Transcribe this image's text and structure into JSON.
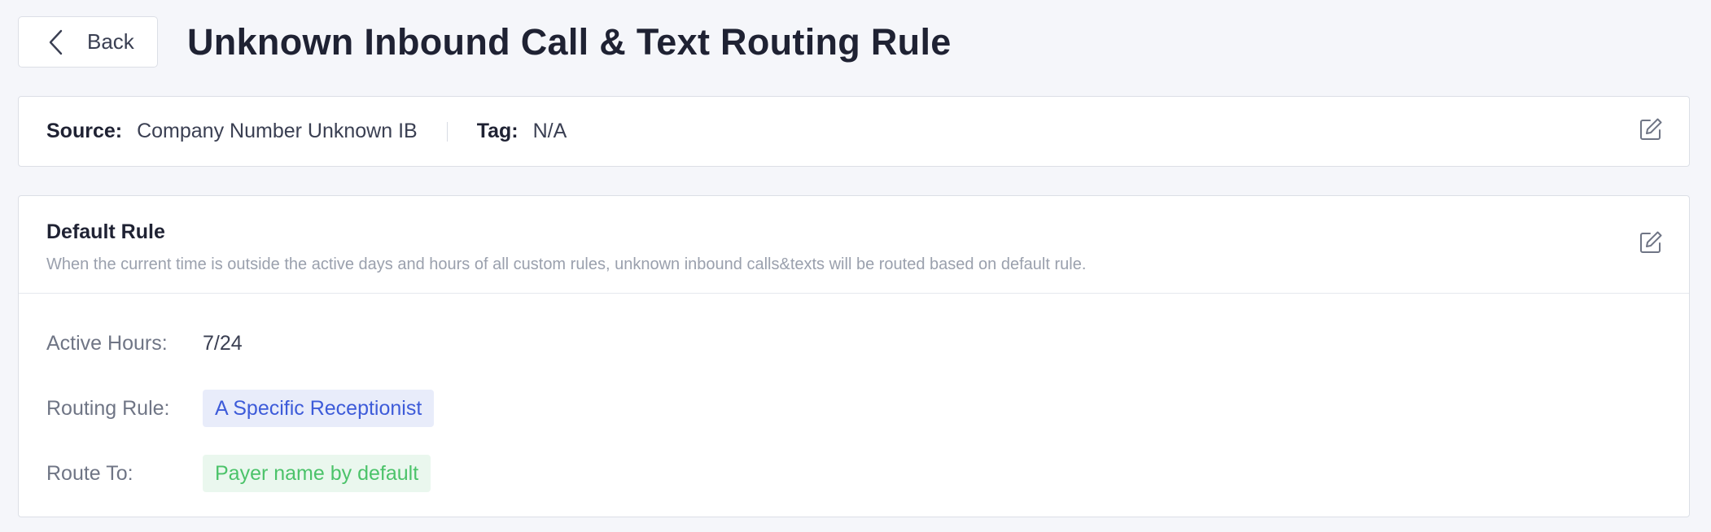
{
  "header": {
    "back_label": "Back",
    "title": "Unknown Inbound Call & Text Routing Rule"
  },
  "source_card": {
    "source_label": "Source:",
    "source_value": "Company Number Unknown IB",
    "tag_label": "Tag:",
    "tag_value": "N/A",
    "edit_icon": "edit-icon"
  },
  "default_rule": {
    "title": "Default Rule",
    "description": "When the current time is outside the active days and hours of all custom rules, unknown inbound calls&texts will be routed based on default rule.",
    "edit_icon": "edit-icon",
    "rows": [
      {
        "label": "Active Hours:",
        "value": "7/24"
      },
      {
        "label": "Routing Rule:",
        "value": "A Specific Receptionist"
      },
      {
        "label": "Route To:",
        "value": "Payer name by default"
      }
    ]
  },
  "colors": {
    "background": "#f5f6fa",
    "routing_tag_bg": "#e8ecfa",
    "routing_tag_text": "#3d5bd9",
    "route_to_tag_bg": "#eaf7ee",
    "route_to_tag_text": "#4cc36a"
  }
}
